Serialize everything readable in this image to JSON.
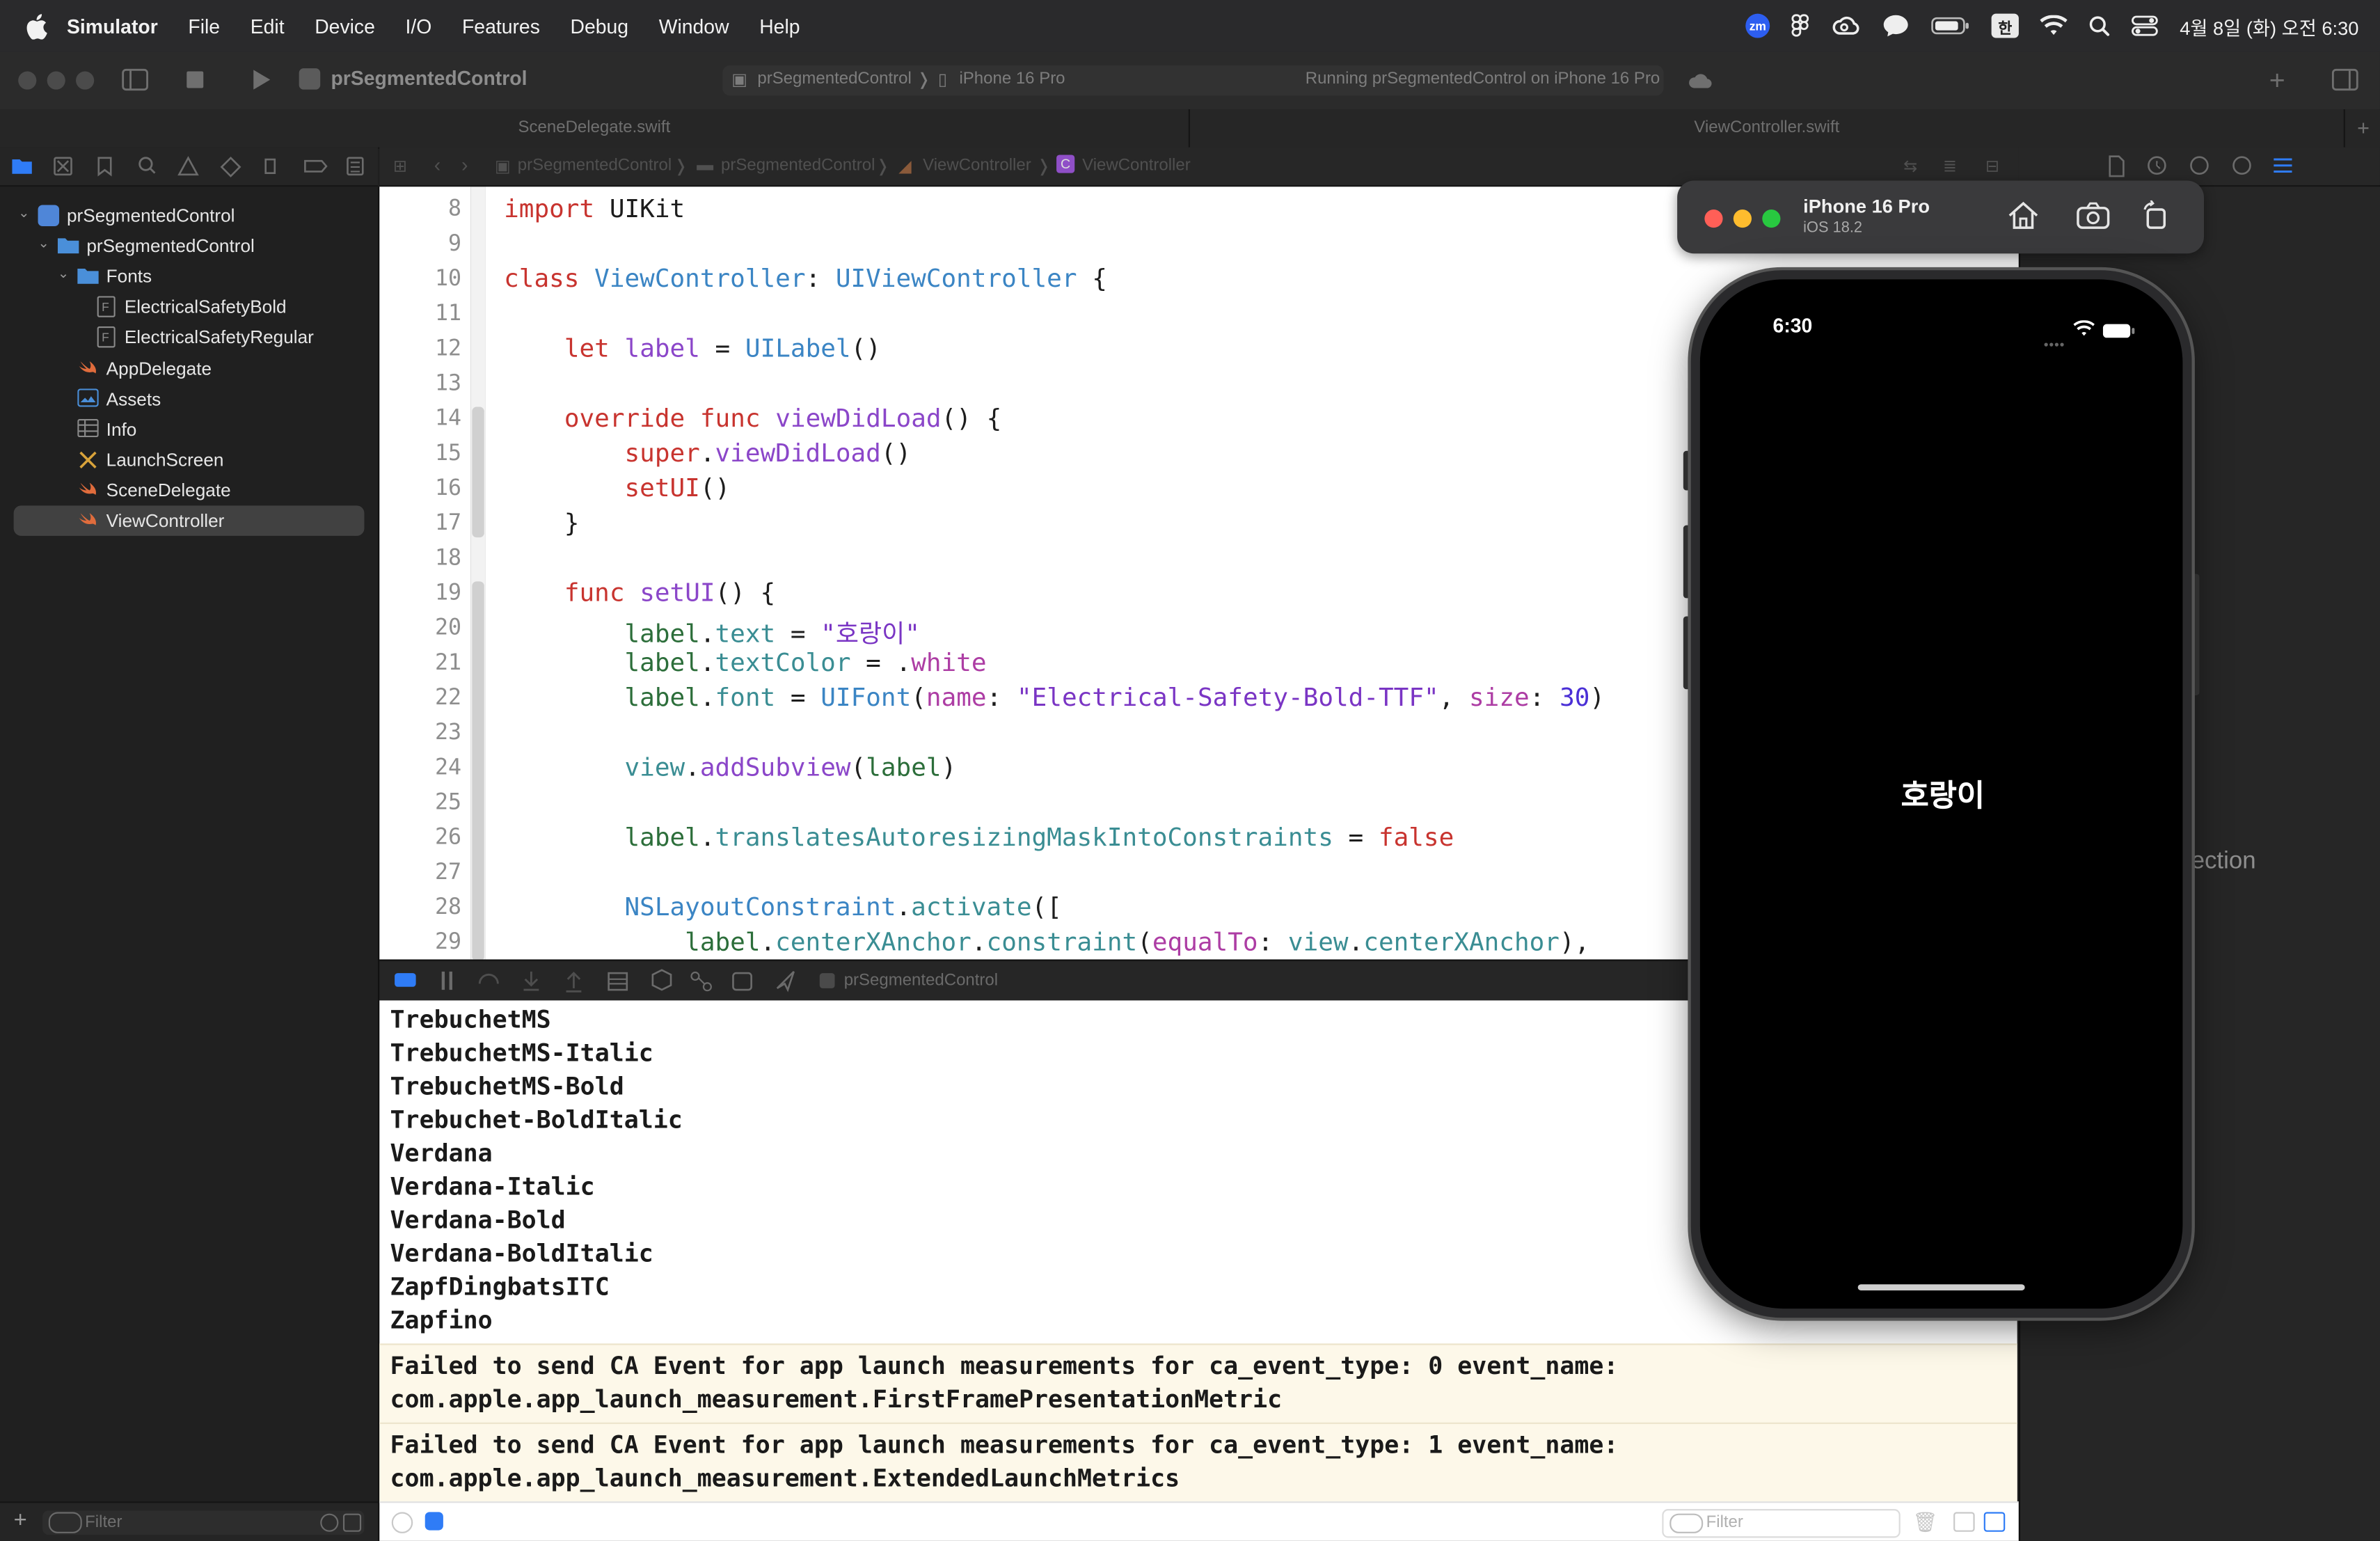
{
  "menubar": {
    "app_name": "Simulator",
    "items": [
      "File",
      "Edit",
      "Device",
      "I/O",
      "Features",
      "Debug",
      "Window",
      "Help"
    ],
    "zoom_label": "zm",
    "ime_label": "한",
    "clock": "4월 8일 (화) 오전 6:30"
  },
  "toolbar": {
    "project_title": "prSegmentedControl",
    "scheme": "prSegmentedControl",
    "destination": "iPhone 16 Pro",
    "run_status": "Running prSegmentedControl on iPhone 16 Pro"
  },
  "tabs": [
    "SceneDelegate.swift",
    "ViewController.swift"
  ],
  "jumpbar": [
    "prSegmentedControl",
    "prSegmentedControl",
    "ViewController",
    "ViewController"
  ],
  "navigator": {
    "items": [
      {
        "label": "prSegmentedControl",
        "type": "project"
      },
      {
        "label": "prSegmentedControl",
        "type": "folder"
      },
      {
        "label": "Fonts",
        "type": "folder"
      },
      {
        "label": "ElectricalSafetyBold",
        "type": "font-file"
      },
      {
        "label": "ElectricalSafetyRegular",
        "type": "font-file"
      },
      {
        "label": "AppDelegate",
        "type": "swift"
      },
      {
        "label": "Assets",
        "type": "assets"
      },
      {
        "label": "Info",
        "type": "plist"
      },
      {
        "label": "LaunchScreen",
        "type": "storyboard"
      },
      {
        "label": "SceneDelegate",
        "type": "swift"
      },
      {
        "label": "ViewController",
        "type": "swift",
        "selected": true
      }
    ],
    "filter_placeholder": "Filter"
  },
  "editor": {
    "line_numbers": [
      "8",
      "9",
      "10",
      "11",
      "12",
      "13",
      "14",
      "15",
      "16",
      "17",
      "18",
      "19",
      "20",
      "21",
      "22",
      "23",
      "24",
      "25",
      "26",
      "27",
      "28",
      "29"
    ],
    "lines": {
      "l8": {
        "a": "import",
        "b": " UIKit"
      },
      "l10": {
        "a": "class",
        "b": " ",
        "c": "ViewController",
        "d": ": ",
        "e": "UIViewController",
        "f": " {"
      },
      "l12": {
        "a": "    ",
        "b": "let",
        "c": " ",
        "d": "label",
        "e": " = ",
        "f": "UILabel",
        "g": "()"
      },
      "l14": {
        "a": "    ",
        "b": "override",
        "c": " ",
        "d": "func",
        "e": " ",
        "f": "viewDidLoad",
        "g": "() {"
      },
      "l15": {
        "a": "        ",
        "b": "super",
        "c": ".",
        "d": "viewDidLoad",
        "e": "()"
      },
      "l16": {
        "a": "        ",
        "b": "setUI",
        "c": "()"
      },
      "l17": {
        "a": "    }"
      },
      "l19": {
        "a": "    ",
        "b": "func",
        "c": " ",
        "d": "setUI",
        "e": "() {"
      },
      "l20": {
        "a": "        ",
        "b": "label",
        "c": ".",
        "d": "text",
        "e": " = ",
        "f": "\"호랑이\""
      },
      "l21": {
        "a": "        ",
        "b": "label",
        "c": ".",
        "d": "textColor",
        "e": " = .",
        "f": "white"
      },
      "l22": {
        "a": "        ",
        "b": "label",
        "c": ".",
        "d": "font",
        "e": " = ",
        "f": "UIFont",
        "g": "(",
        "h": "name",
        "i": ": ",
        "j": "\"Electrical-Safety-Bold-TTF\"",
        "k": ", ",
        "l": "size",
        "m": ": ",
        "n": "30",
        "o": ")"
      },
      "l24": {
        "a": "        ",
        "b": "view",
        "c": ".",
        "d": "addSubview",
        "e": "(",
        "f": "label",
        "g": ")"
      },
      "l26": {
        "a": "        ",
        "b": "label",
        "c": ".",
        "d": "translatesAutoresizingMaskIntoConstraints",
        "e": " = ",
        "f": "false"
      },
      "l28": {
        "a": "        ",
        "b": "NSLayoutConstraint",
        "c": ".",
        "d": "activate",
        "e": "(["
      },
      "l29": {
        "a": "            ",
        "b": "label",
        "c": ".",
        "d": "centerXAnchor",
        "e": ".",
        "f": "constraint",
        "g": "(",
        "h": "equalTo",
        "i": ": ",
        "j": "view",
        "k": ".",
        "l": "centerXAnchor",
        "m": "),"
      }
    }
  },
  "debugbar": {
    "target": "prSegmentedControl"
  },
  "console": {
    "font_lines": [
      "TrebuchetMS",
      "TrebuchetMS-Italic",
      "TrebuchetMS-Bold",
      "Trebuchet-BoldItalic",
      "Verdana",
      "Verdana-Italic",
      "Verdana-Bold",
      "Verdana-BoldItalic",
      "ZapfDingbatsITC",
      "Zapfino"
    ],
    "warnings": [
      {
        "line1": "Failed to send CA Event for app launch measurements for ca_event_type: 0 event_name:",
        "line2": "com.apple.app_launch_measurement.FirstFramePresentationMetric"
      },
      {
        "line1": "Failed to send CA Event for app launch measurements for ca_event_type: 1 event_name:",
        "line2": "com.apple.app_launch_measurement.ExtendedLaunchMetrics"
      }
    ],
    "filter_placeholder": "Filter"
  },
  "inspector": {
    "partial_text": "lection"
  },
  "simulator": {
    "device_name": "iPhone 16 Pro",
    "os_version": "iOS 18.2",
    "status_time": "6:30",
    "label_text": "호랑이"
  },
  "colors": {
    "traffic_close": "#ff5f57",
    "traffic_min": "#febc2e",
    "traffic_max": "#28c840",
    "accent": "#2f7cf6"
  }
}
